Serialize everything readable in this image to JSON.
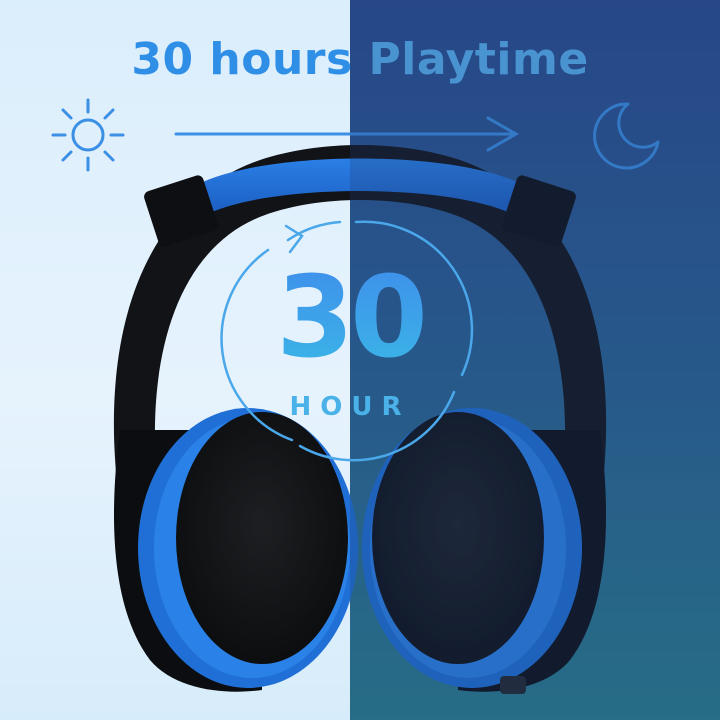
{
  "banner": {
    "title_part1": "30 hours",
    "title_part2": "Playtime"
  },
  "badge": {
    "number": "30",
    "unit": "HOUR"
  },
  "icons": {
    "day": "sun-icon",
    "night": "moon-icon",
    "direction": "arrow-right-icon",
    "cycle": "circular-arrow-icon"
  },
  "colors": {
    "day_background": "#dbeefc",
    "night_background": "#2a4a8e",
    "accent_blue": "#2f8fe6",
    "cup_blue": "#1f6fd6",
    "headphone_black": "#121417"
  }
}
